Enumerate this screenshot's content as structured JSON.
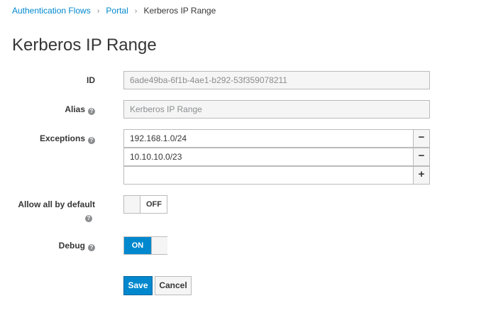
{
  "breadcrumb": [
    {
      "label": "Authentication Flows"
    },
    {
      "label": "Portal"
    },
    {
      "label": "Kerberos IP Range"
    }
  ],
  "breadcrumb_separator": "›",
  "page_title": "Kerberos IP Range",
  "form": {
    "id": {
      "label": "ID",
      "value": "6ade49ba-6f1b-4ae1-b292-53f359078211"
    },
    "alias": {
      "label": "Alias",
      "value": "Kerberos IP Range"
    },
    "exceptions": {
      "label": "Exceptions",
      "values": [
        "192.168.1.0/24",
        "10.10.10.0/23",
        ""
      ],
      "remove_symbol": "−",
      "add_symbol": "+"
    },
    "allow_all_by_default": {
      "label": "Allow all by default",
      "state": "OFF"
    },
    "debug": {
      "label": "Debug",
      "state": "ON"
    },
    "help_symbol": "?"
  },
  "actions": {
    "save_label": "Save",
    "cancel_label": "Cancel"
  },
  "colors": {
    "accent": "#0088ce",
    "link": "#0088ce",
    "border": "#bbbbbb",
    "readonly_bg": "#f5f5f5"
  }
}
